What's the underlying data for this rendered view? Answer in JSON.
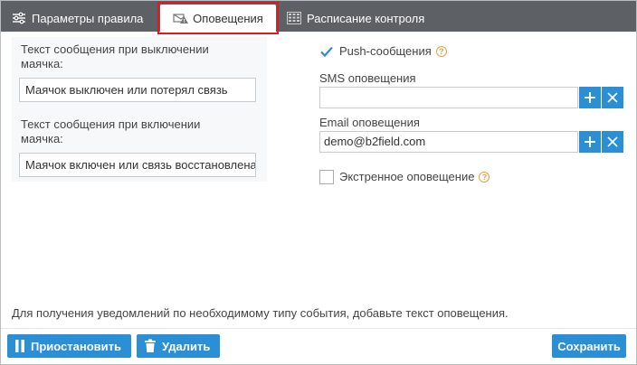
{
  "tabs": [
    {
      "label": "Параметры правила",
      "icon": "sliders-icon"
    },
    {
      "label": "Оповещения",
      "icon": "envelope-warning-icon",
      "active": true
    },
    {
      "label": "Расписание контроля",
      "icon": "calendar-grid-icon"
    }
  ],
  "left": {
    "off_label": "Текст сообщения при выключении маячка:",
    "off_value": "Маячок выключен или потерял связь",
    "on_label": "Текст сообщения при включении маячка:",
    "on_value": "Маячок включен или связь восстановлена"
  },
  "right": {
    "push_label": "Push-сообщения",
    "push_checked": true,
    "sms_label": "SMS оповещения",
    "sms_value": "",
    "email_label": "Email оповещения",
    "email_value": "demo@b2field.com",
    "urgent_label": "Экстренное оповещение",
    "urgent_checked": false,
    "help_glyph": "?"
  },
  "hint": "Для получения уведомлений по необходимому типу события, добавьте текст оповещения.",
  "buttons": {
    "pause": "Приостановить",
    "delete": "Удалить",
    "save": "Сохранить"
  },
  "colors": {
    "accent": "#2b8fd6",
    "tabbar": "#5d6166",
    "highlight": "#e0191e",
    "help": "#e6a23c"
  }
}
